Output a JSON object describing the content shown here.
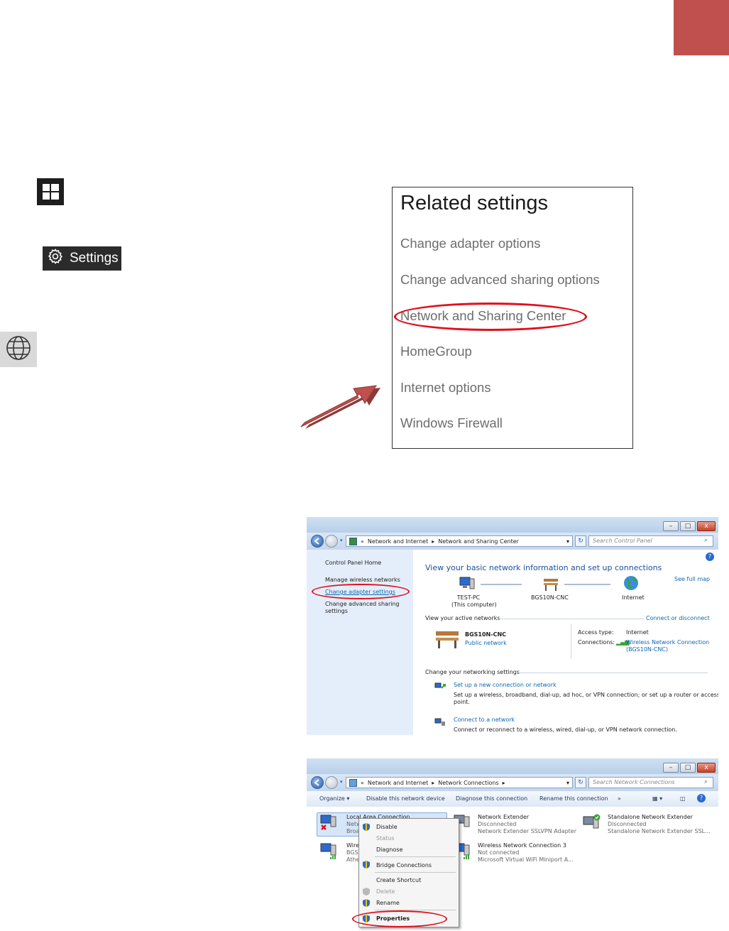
{
  "colors": {
    "accent_red": "#c0504d",
    "link_blue": "#0c66b5",
    "highlight_red": "#e0101e"
  },
  "settings_button": {
    "label": "Settings",
    "icon": "gear-icon"
  },
  "related": {
    "title": "Related settings",
    "links": [
      "Change adapter options",
      "Change advanced sharing options",
      "Network and Sharing Center",
      "HomeGroup",
      "Internet options",
      "Windows Firewall"
    ]
  },
  "nsc": {
    "breadcrumb": [
      "«",
      "Network and Internet",
      "Network and Sharing Center"
    ],
    "search_placeholder": "Search Control Panel",
    "sidebar": [
      "Control Panel Home",
      "Manage wireless networks",
      "Change adapter settings",
      "Change advanced sharing settings"
    ],
    "heading": "View your basic network information and set up connections",
    "see_full_map": "See full map",
    "map": [
      {
        "label": "TEST-PC",
        "sublabel": "(This computer)"
      },
      {
        "label": "BGS10N-CNC"
      },
      {
        "label": "Internet"
      }
    ],
    "active_networks_label": "View your active networks",
    "connect_disconnect": "Connect or disconnect",
    "network_name": "BGS10N-CNC",
    "network_type": "Public network",
    "access_type_label": "Access type:",
    "access_type_value": "Internet",
    "connections_label": "Connections:",
    "connections_value_1": "Wireless Network Connection",
    "connections_value_2": "(BGS10N-CNC)",
    "change_settings_label": "Change your networking settings",
    "tasks": [
      {
        "title": "Set up a new connection or network",
        "desc": "Set up a wireless, broadband, dial-up, ad hoc, or VPN connection; or set up a router or access",
        "desc2": "point."
      },
      {
        "title": "Connect to a network",
        "desc": "Connect or reconnect to a wireless, wired, dial-up, or VPN network connection."
      }
    ]
  },
  "netconn": {
    "breadcrumb": [
      "«",
      "Network and Internet",
      "Network Connections"
    ],
    "search_placeholder": "Search Network Connections",
    "toolbar": [
      "Organize ▾",
      "Disable this network device",
      "Diagnose this connection",
      "Rename this connection",
      "»"
    ],
    "adapters": [
      {
        "name": "Local Area Connection",
        "line2": "Netw",
        "line3": "Broa"
      },
      {
        "name": "Wire",
        "line2": "BGS",
        "line3": "Athe"
      },
      {
        "name": "Network Extender",
        "line2": "Disconnected",
        "line3": "Network Extender SSLVPN Adapter"
      },
      {
        "name": "Wireless Network Connection 3",
        "line2": "Not connected",
        "line3": "Microsoft Virtual WiFi Miniport A..."
      },
      {
        "name": "Standalone Network Extender",
        "line2": "Disconnected",
        "line3": "Standalone Network Extender SSL..."
      }
    ],
    "context_menu": [
      "Disable",
      "Status",
      "Diagnose",
      "Bridge Connections",
      "Create Shortcut",
      "Delete",
      "Rename",
      "Properties"
    ]
  }
}
